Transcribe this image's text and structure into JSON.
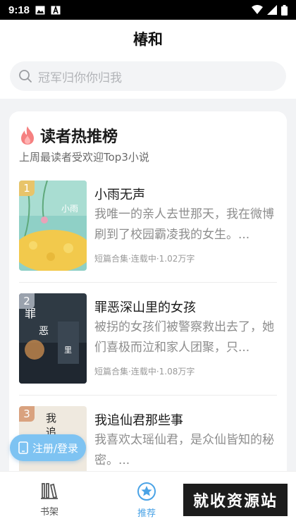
{
  "status_bar": {
    "time": "9:18"
  },
  "header": {
    "title": "椿和"
  },
  "search": {
    "placeholder": "冠军归你你归我"
  },
  "ranking": {
    "title": "读者热推榜",
    "subtitle": "上周最读者受欢迎Top3小说",
    "books": [
      {
        "rank": "1",
        "title": "小雨无声",
        "description": "我唯一的亲人去世那天，我在微博刷到了校园霸凌我的女生。...",
        "meta": "短篇合集·连载中·1.02万字",
        "rank_color": "#e8c46a"
      },
      {
        "rank": "2",
        "title": "罪恶深山里的女孩",
        "description": "被拐的女孩们被警察救出去了，她们喜极而泣和家人团聚，只...",
        "meta": "短篇合集·连载中·1.08万字",
        "rank_color": "#9aa2ad"
      },
      {
        "rank": "3",
        "title": "我追仙君那些事",
        "description": "我喜欢太瑶仙君，是众仙皆知的秘密。...",
        "meta": "",
        "rank_color": "#d9a27f"
      }
    ]
  },
  "register_button": {
    "label": "注册/登录"
  },
  "tabs": [
    {
      "label": "书架",
      "icon": "bookshelf-icon",
      "active": false
    },
    {
      "label": "推荐",
      "icon": "recommend-star-icon",
      "active": true
    }
  ],
  "watermark": {
    "text": "就收资源站"
  },
  "colors": {
    "accent": "#4aa3e6",
    "register_bg": "#7ec3f2",
    "fire": "#f06a6a"
  }
}
